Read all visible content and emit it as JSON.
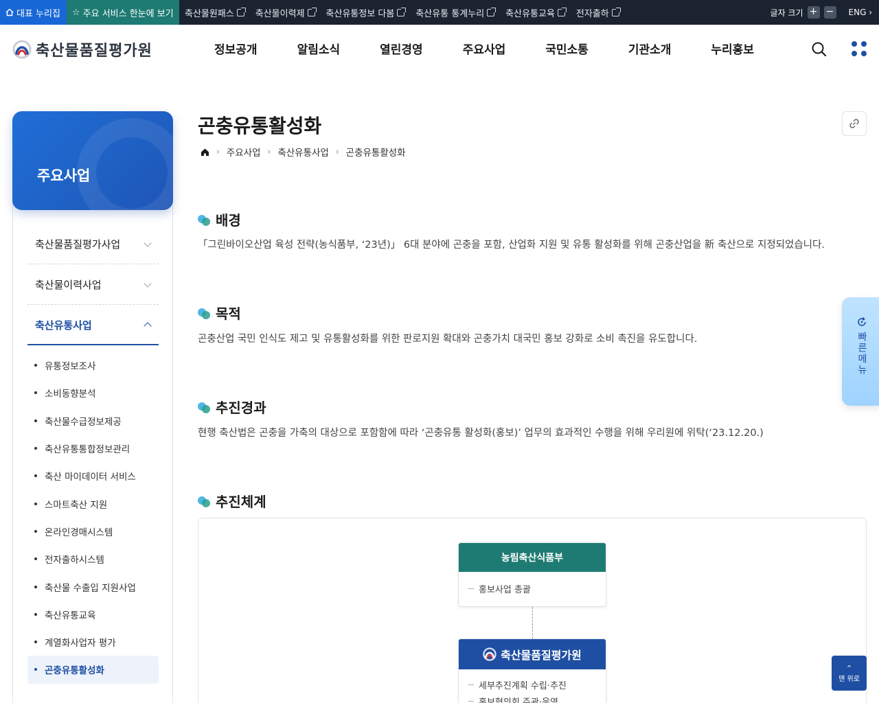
{
  "topbar": {
    "home_label": "대표 누리집",
    "star_label": "주요 서비스 한눈에 보기",
    "links": [
      "축산물원패스",
      "축산물이력제",
      "축산유통정보 다봄",
      "축산유통 통계누리",
      "축산유통교육",
      "전자출하"
    ],
    "font_size_label": "글자 크기",
    "plus": "+",
    "minus": "−",
    "lang_label": "ENG"
  },
  "header": {
    "logo_text": "축산물품질평가원",
    "nav": [
      "정보공개",
      "알림소식",
      "열린경영",
      "주요사업",
      "국민소통",
      "기관소개",
      "누리홍보"
    ]
  },
  "sidebar": {
    "title": "주요사업",
    "groups": [
      {
        "label": "축산물품질평가사업"
      },
      {
        "label": "축산물이력사업"
      },
      {
        "label": "축산유통사업"
      }
    ],
    "sub_items": [
      "유통정보조사",
      "소비동향분석",
      "축산물수급정보제공",
      "축산유통통합정보관리",
      "축산 마이데이터 서비스",
      "스마트축산 지원",
      "온라인경매시스템",
      "전자출하시스템",
      "축산물 수출입 지원사업",
      "축산유통교육",
      "계열화사업자 평가",
      "곤충유통활성화"
    ]
  },
  "page": {
    "title": "곤충유통활성화",
    "breadcrumb": [
      "주요사업",
      "축산유통사업",
      "곤충유통활성화"
    ],
    "sections": [
      {
        "title": "배경",
        "text": "「그린바이오산업 육성 전략(농식품부, ‘23년)」 6대 분야에 곤충을 포함, 산업화 지원 및 유통 활성화를 위해 곤충산업을 新 축산으로 지정되었습니다."
      },
      {
        "title": "목적",
        "text": "곤충산업 국민 인식도 제고 및 유통활성화를 위한 판로지원 확대와 곤충가치 대국민 홍보 강화로 소비 촉진을 유도합니다."
      },
      {
        "title": "추진경과",
        "text": "현행 축산법은 곤충을 가축의 대상으로 포함함에 따라 ‘곤충유통 활성화(홍보)’ 업무의 효과적인 수행을 위해 우리원에 위탁(‘23.12.20.)"
      },
      {
        "title": "추진체계",
        "text": ""
      }
    ],
    "org": {
      "ministry": "농림축산식품부",
      "ministry_role": "홍보사업 총괄",
      "agency": "축산물품질평가원",
      "agency_roles": [
        "세부추진계획 수립·추진",
        "홍보협의회 주관·운영"
      ]
    }
  },
  "quick_menu": {
    "label": "빠른메뉴"
  },
  "top_button": {
    "label": "맨 위로"
  }
}
